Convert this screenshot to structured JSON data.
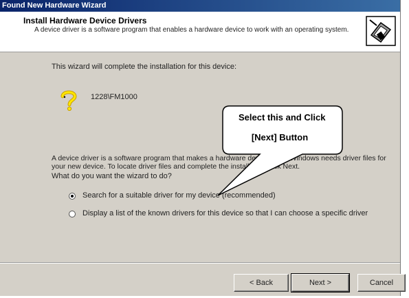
{
  "window": {
    "title": "Found New Hardware Wizard"
  },
  "header": {
    "title": "Install Hardware Device Drivers",
    "description": "A device driver is a software program that enables a hardware device to work with an operating system."
  },
  "content": {
    "intro": "This wizard will complete the installation for this device:",
    "device_name": "1228\\FM1000",
    "paragraph": "A device driver is a software program that makes a hardware device work. Windows needs driver files for your new device. To locate driver files and complete the installation click Next.",
    "question": "What do you want the wizard to do?",
    "options": [
      {
        "label": "Search for a suitable driver for my device (recommended)",
        "selected": true
      },
      {
        "label": "Display a list of the known drivers for this device so that I can choose a specific driver",
        "selected": false
      }
    ]
  },
  "callout": {
    "line1": "Select this and Click",
    "line2": "[Next] Button"
  },
  "buttons": {
    "back": "< Back",
    "next": "Next >",
    "cancel": "Cancel"
  },
  "colors": {
    "titlebar_start": "#0a246a",
    "titlebar_end": "#3a6ea5",
    "dialog_bg": "#d4d0c8"
  }
}
